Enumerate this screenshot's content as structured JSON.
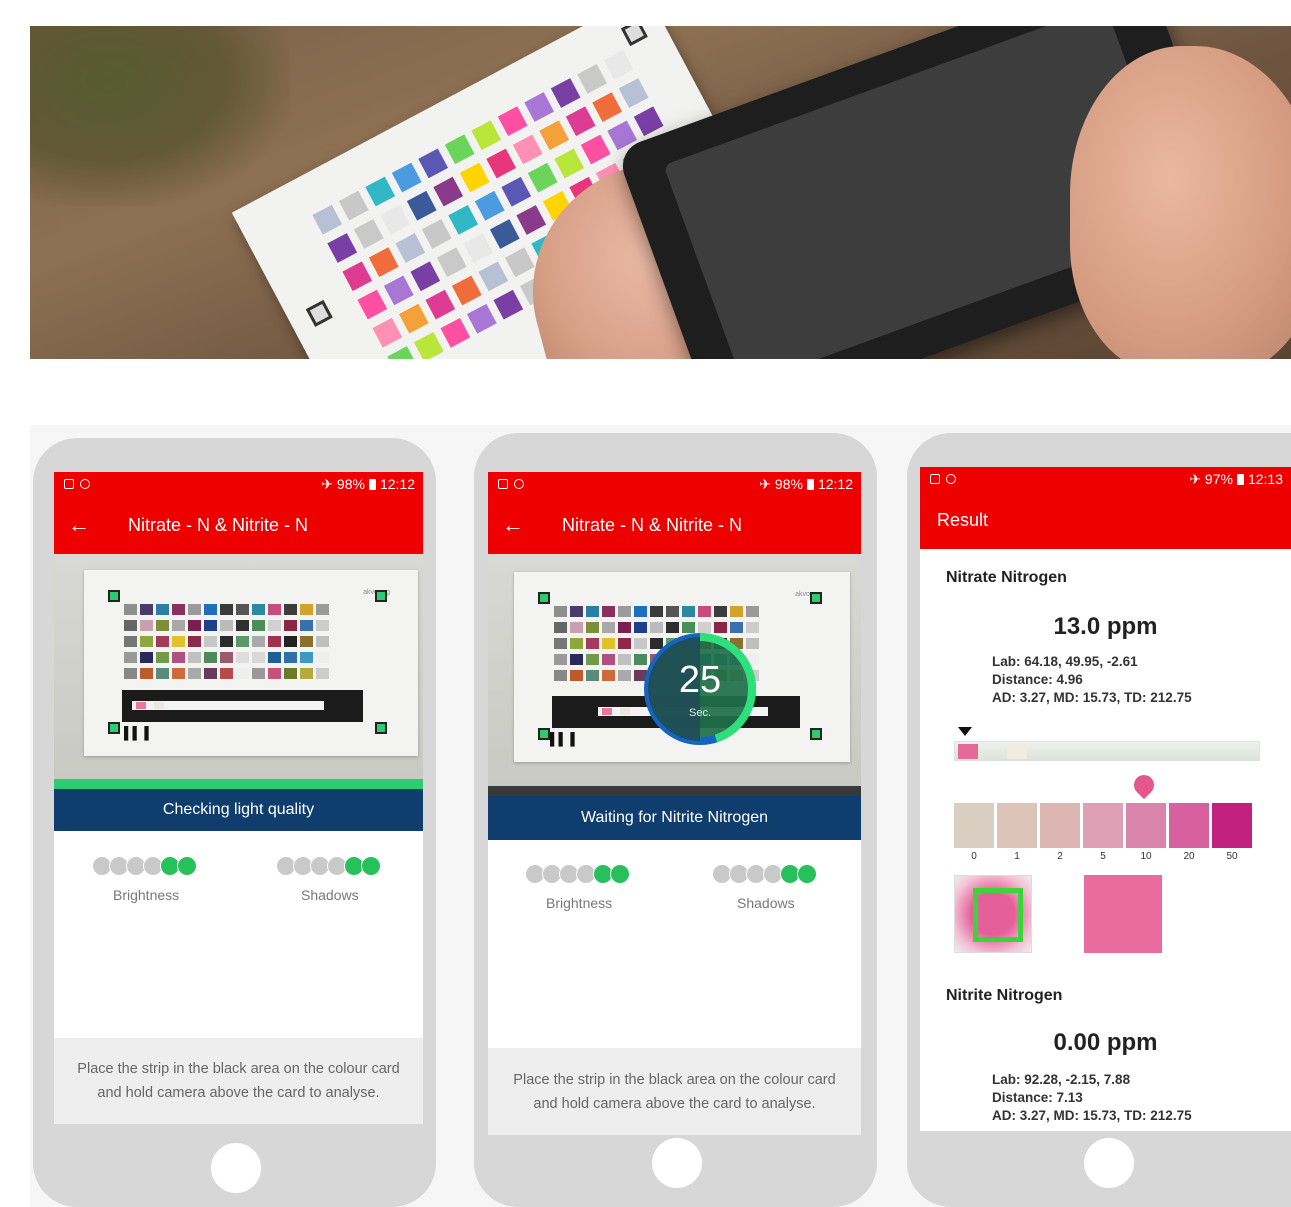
{
  "phone1": {
    "status": {
      "right": "98%",
      "time": "12:12"
    },
    "appbar_title": "Nitrate - N & Nitrite - N",
    "card_logo": "akvo.org",
    "banner": "Checking light quality",
    "brightness_label": "Brightness",
    "shadows_label": "Shadows",
    "footer": "Place the strip in the black area on the colour card and hold camera above the card to analyse."
  },
  "phone2": {
    "status": {
      "right": "98%",
      "time": "12:12"
    },
    "appbar_title": "Nitrate - N & Nitrite - N",
    "card_logo": "akvo.org",
    "timer_value": "25",
    "timer_unit": "Sec.",
    "timer_progress": 0.45,
    "banner": "Waiting for Nitrite Nitrogen",
    "brightness_label": "Brightness",
    "shadows_label": "Shadows",
    "footer": "Place the strip in the black area on the colour card and hold camera above the card to analyse."
  },
  "phone3": {
    "status": {
      "right": "97%",
      "time": "12:13"
    },
    "appbar_title": "Result",
    "results": [
      {
        "name": "Nitrate Nitrogen",
        "value": "13.0 ppm",
        "lab": "Lab: 64.18, 49.95, -2.61",
        "distance": "Distance: 4.96",
        "stats": "AD: 3.27, MD: 15.73, TD: 212.75",
        "scale": [
          "0",
          "1",
          "2",
          "5",
          "10",
          "20",
          "50"
        ]
      },
      {
        "name": "Nitrite Nitrogen",
        "value": "0.00 ppm",
        "lab": "Lab: 92.28, -2.15, 7.88",
        "distance": "Distance: 7.13",
        "stats": "AD: 3.27, MD: 15.73, TD: 212.75"
      }
    ]
  },
  "colors": {
    "brand_red": "#ee0000",
    "banner_blue": "#0f3e6e",
    "quality_green": "#26c15a",
    "scale_swatches": [
      "#d9cfc0",
      "#dcc4b8",
      "#dcb6b2",
      "#dda0b4",
      "#d984aa",
      "#d9609f",
      "#c2217f"
    ]
  }
}
